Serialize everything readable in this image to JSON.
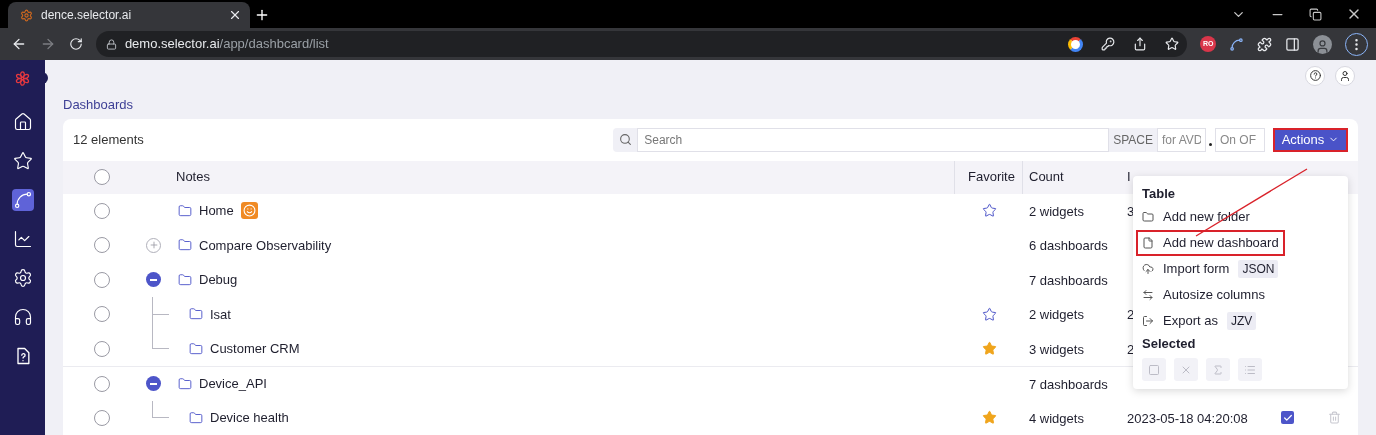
{
  "browser": {
    "tab": {
      "title": "dence.selector.ai"
    },
    "address": {
      "host": "demo.selector.ai",
      "path": "/app/dashbcard/list"
    },
    "extension_badge": "RO"
  },
  "sidebar": {
    "items": [
      {
        "selected": false
      },
      {
        "selected": false
      },
      {
        "selected": true
      },
      {
        "selected": false
      },
      {
        "selected": false
      },
      {
        "selected": false
      },
      {
        "selected": false
      }
    ]
  },
  "page_title": "Dashboards",
  "toolbar": {
    "count": "12 elements",
    "search": {
      "placeholder": "Search"
    },
    "space_label": "SPACE",
    "filter_1": {
      "placeholder": "for AVD"
    },
    "filter_2": {
      "placeholder": "On OF"
    },
    "actions_button": {
      "label": "Actions",
      "highlighted": true
    }
  },
  "table": {
    "select_all": {
      "selected": false
    },
    "columns": [
      {
        "label": "Notes"
      },
      {
        "label": "Favorite"
      },
      {
        "label": "Count"
      },
      {
        "label": "I"
      }
    ],
    "rows": [
      {
        "name": "Home",
        "badge": true,
        "selected": false,
        "favorite": false,
        "count": "2 widgets",
        "column_4": "3"
      },
      {
        "name": "Compare Observability",
        "selected": false,
        "expanded": false,
        "count": "6 dashboards"
      },
      {
        "name": "Debug",
        "selected": false,
        "expanded": true,
        "count": "7 dashboards",
        "children": [
          {
            "name": "Isat",
            "selected": false,
            "favorite": false,
            "count": "2 widgets",
            "column_4": "2"
          },
          {
            "name": "Customer CRM",
            "selected": false,
            "favorite": true,
            "count": "3 widgets",
            "column_4": "2"
          }
        ]
      },
      {
        "name": "Device_API",
        "selected": false,
        "expanded": true,
        "count": "7 dashboards",
        "children": [
          {
            "name": "Device health",
            "selected": false,
            "favorite": true,
            "count": "4 widgets",
            "column_4": "2023-05-18 04:20:08",
            "checked": true
          }
        ]
      }
    ]
  },
  "actions_menu": {
    "sections": [
      {
        "title": "Table",
        "items": [
          {
            "label": "Add new folder",
            "highlighted": false
          },
          {
            "label": "Add new dashboard",
            "highlighted": true
          },
          {
            "label": "Import form",
            "tag": "JSON",
            "highlighted": false
          },
          {
            "label": "Autosize columns",
            "highlighted": false
          },
          {
            "label": "Export as",
            "tag": "JZV",
            "highlighted": false
          }
        ]
      },
      {
        "title": "Selected",
        "buttons": [
          {
            "disabled": true
          },
          {
            "disabled": true
          },
          {
            "disabled": true
          },
          {
            "disabled": true
          }
        ]
      }
    ]
  }
}
